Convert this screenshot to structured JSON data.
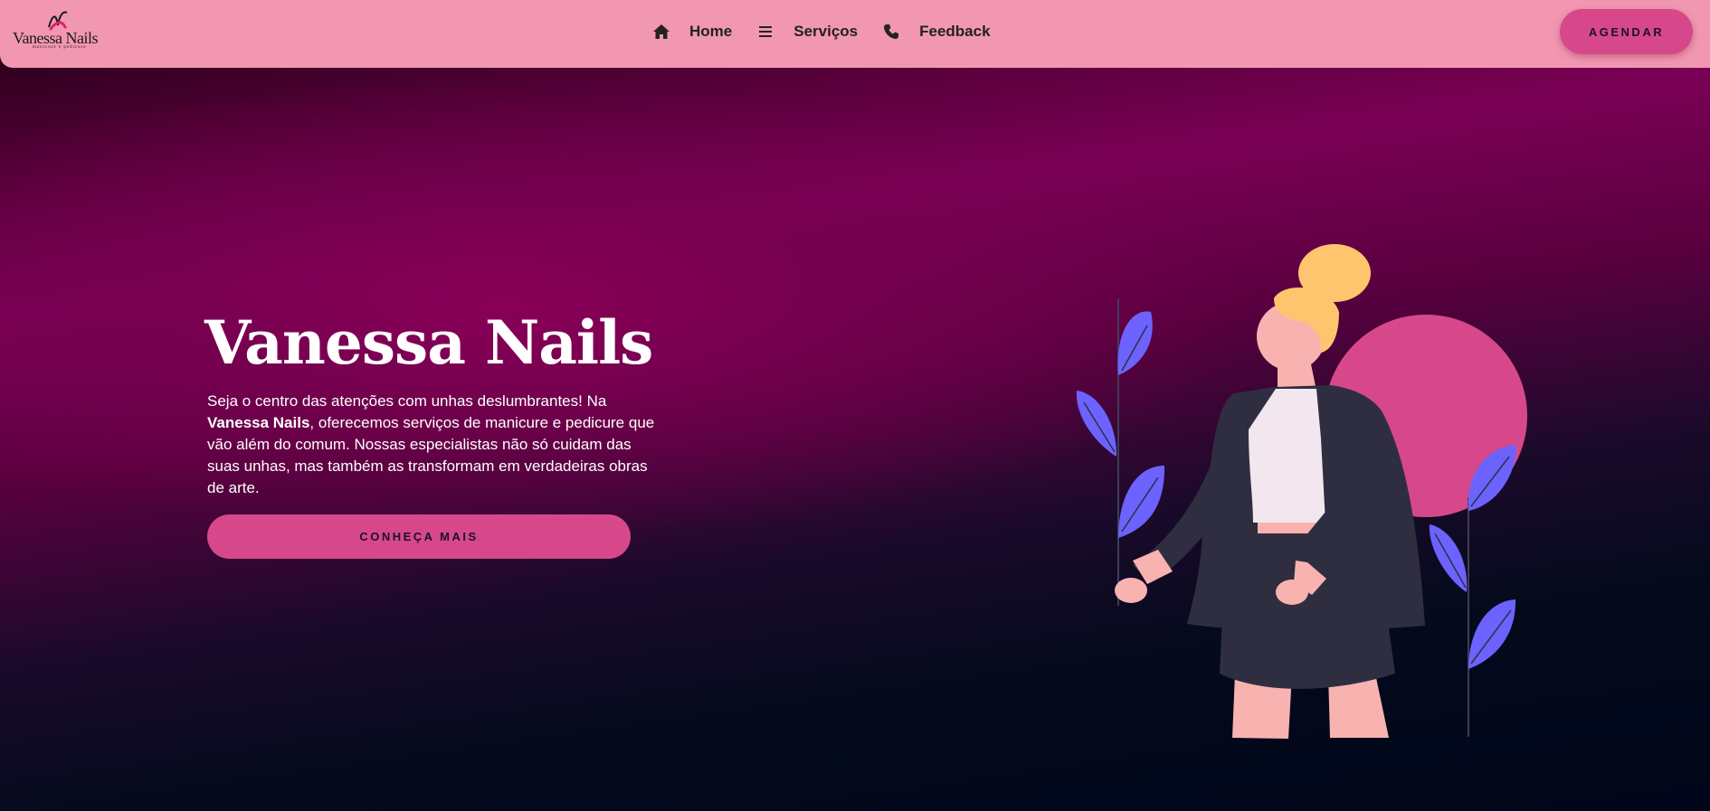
{
  "header": {
    "logo": {
      "name": "Vanessa Nails",
      "tagline": "manicure e pedicure"
    },
    "nav": [
      {
        "label": "Home",
        "icon": "home-icon"
      },
      {
        "label": "Serviços",
        "icon": "menu-icon"
      },
      {
        "label": "Feedback",
        "icon": "phone-icon"
      }
    ],
    "cta_label": "AGENDAR"
  },
  "hero": {
    "title": "Vanessa Nails",
    "text_before": "Seja o centro das atenções com unhas deslumbrantes! Na ",
    "text_bold": "Vanessa Nails",
    "text_after": ", oferecemos serviços de manicure e pedicure que vão além do comum. Nossas especialistas não só cuidam das suas unhas, mas também as transformam em verdadeiras obras de arte.",
    "button_label": "CONHEÇA MAIS"
  },
  "colors": {
    "header_bg": "#f297b1",
    "accent": "#d7488a",
    "text_dark": "#222222",
    "leaf": "#6c63ff",
    "jacket": "#2f2e41",
    "skin": "#f8b3b0",
    "hair": "#ffc56e"
  }
}
